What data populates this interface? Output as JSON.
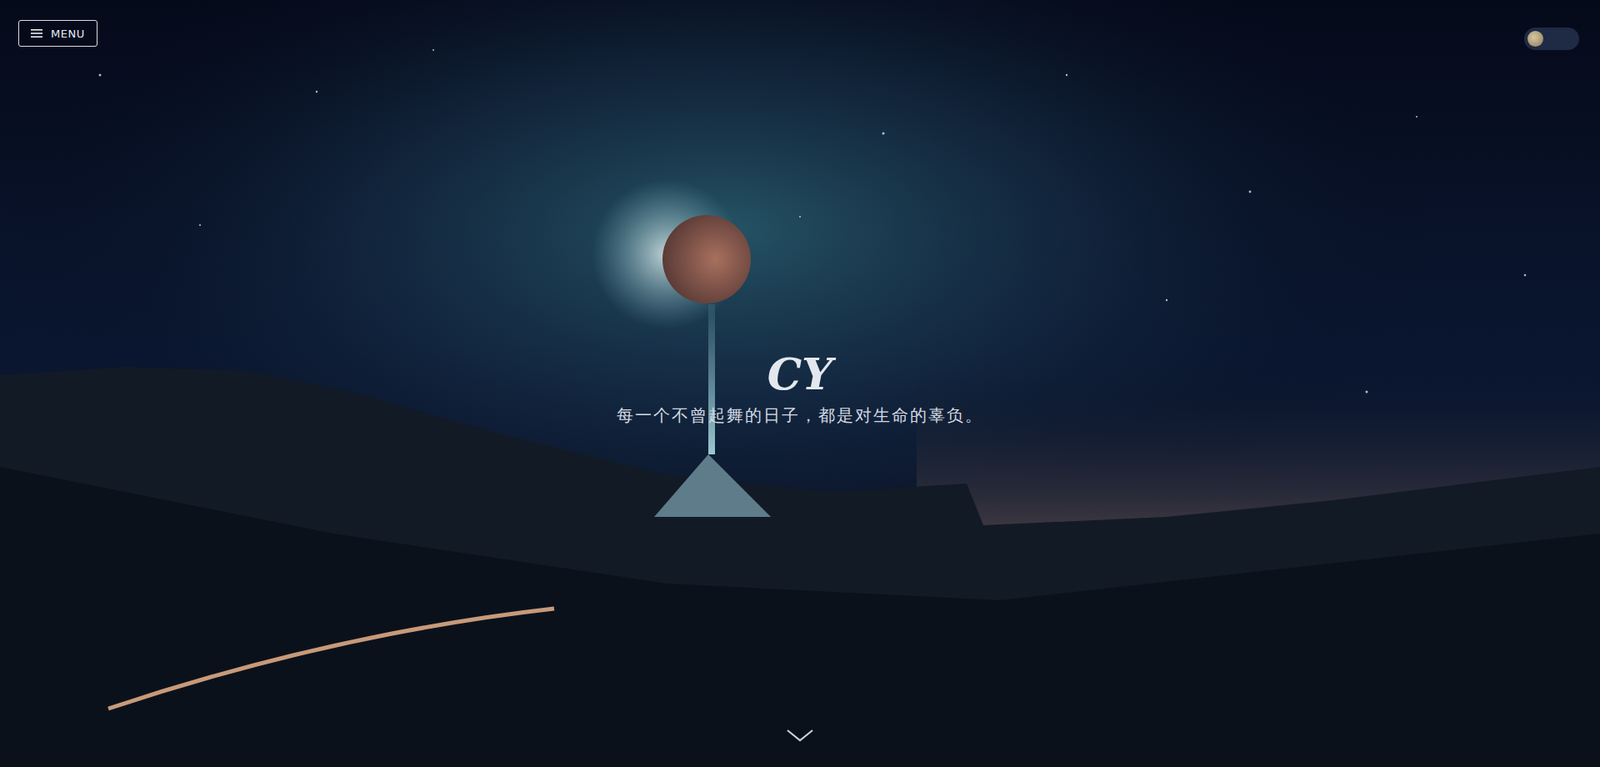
{
  "menu_button": {
    "label": "MENU"
  },
  "theme_toggle": {
    "on": true
  },
  "hero": {
    "title": "CY",
    "subtitle": "每一个不曾起舞的日子，都是对生命的辜负。"
  }
}
